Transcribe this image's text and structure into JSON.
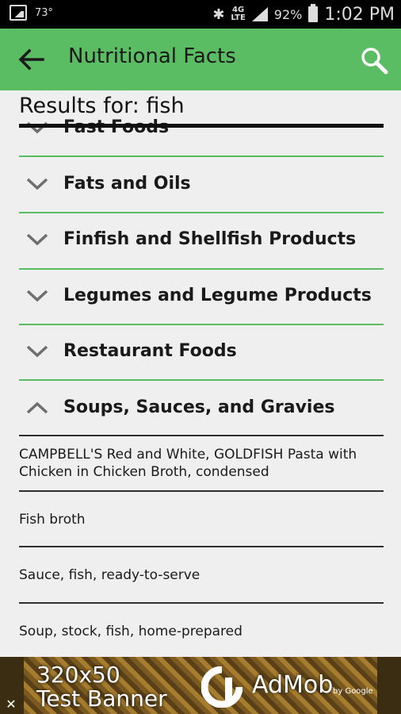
{
  "status": {
    "temperature": "73°",
    "network": "4G LTE",
    "battery_pct": "92%",
    "time": "1:02 PM"
  },
  "toolbar": {
    "title": "Nutritional Facts",
    "back_icon": "arrow-left-icon",
    "search_icon": "search-icon"
  },
  "results_label": "Results for: fish",
  "groups": [
    {
      "label": "Fast Foods",
      "expanded": false
    },
    {
      "label": "Fats and Oils",
      "expanded": false
    },
    {
      "label": "Finfish and Shellfish Products",
      "expanded": false
    },
    {
      "label": "Legumes and Legume Products",
      "expanded": false
    },
    {
      "label": "Restaurant Foods",
      "expanded": false
    },
    {
      "label": "Soups, Sauces, and Gravies",
      "expanded": true
    }
  ],
  "items": [
    "CAMPBELL'S Red and White, GOLDFISH Pasta with Chicken in Chicken Broth, condensed",
    "Fish broth",
    "Sauce, fish, ready-to-serve",
    "Soup, stock, fish, home-prepared"
  ],
  "ad": {
    "line1": "320x50",
    "line2": "Test Banner",
    "brand": "AdMob",
    "by": "by Google",
    "close": "✕"
  },
  "colors": {
    "accent": "#5bbd63",
    "background": "#efefef"
  }
}
